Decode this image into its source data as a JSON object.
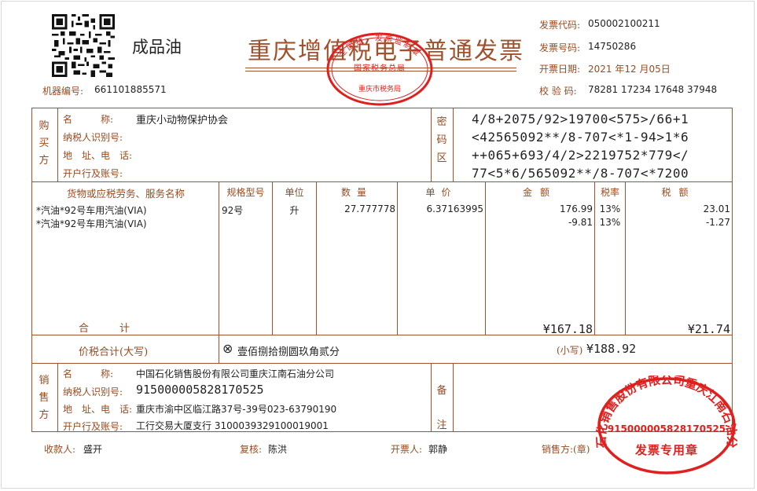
{
  "header": {
    "product_type": "成品油",
    "title": "重庆增值税电子普通发票",
    "machine_no_label": "机器编号:",
    "machine_no": "661101885571",
    "invoice_code_label": "发票代码:",
    "invoice_code": "050002100211",
    "invoice_no_label": "发票号码:",
    "invoice_no": "14750286",
    "issue_date_label": "开票日期:",
    "issue_date": "2021 年12 月05日",
    "check_code_label": "校 验 码:",
    "check_code": "78281 17234 17648 37948"
  },
  "buyer": {
    "section_label": "购买方",
    "name_label": "名　　　称:",
    "name": "重庆小动物保护协会",
    "tax_id_label": "纳税人识别号:",
    "tax_id": "",
    "address_label": "地　址、电　话:",
    "address": "",
    "bank_label": "开户行及账号:",
    "bank": ""
  },
  "cipher": {
    "section_label": "密码区",
    "lines": [
      "4/8+2075/92>19700<575>/66+1",
      "<42565092**/8-707<*1-94>1*6",
      "++065+693/4/2>2219752*779</",
      "77<5*6/565092**/8-707<*7200"
    ]
  },
  "items_table": {
    "headers": {
      "name": "货物或应税劳务、服务名称",
      "spec": "规格型号",
      "unit": "单位",
      "qty": "数量",
      "price": "单价",
      "amount": "金额",
      "rate": "税率",
      "tax": "税额"
    },
    "rows": [
      {
        "name": "*汽油*92号车用汽油(VIA)",
        "spec": "92号",
        "unit": "升",
        "qty": "27.777778",
        "price": "6.37163995",
        "amount": "176.99",
        "rate": "13%",
        "tax": "23.01"
      },
      {
        "name": "*汽油*92号车用汽油(VIA)",
        "spec": "",
        "unit": "",
        "qty": "",
        "price": "",
        "amount": "-9.81",
        "rate": "13%",
        "tax": "-1.27"
      }
    ],
    "total_label": "合　　　计",
    "total_amount": "¥167.18",
    "total_tax": "¥21.74"
  },
  "price_tax_total": {
    "label": "价税合计(大写)",
    "uppercase_symbol": "⊗",
    "uppercase": "壹佰捌拾捌圆玖角贰分",
    "lowercase_label": "(小写)",
    "lowercase": "¥188.92"
  },
  "seller": {
    "section_label": "销售方",
    "name_label": "名　　　称:",
    "name": "中国石化销售股份有限公司重庆江南石油分公司",
    "tax_id_label": "纳税人识别号:",
    "tax_id": "915000005828170525",
    "address_label": "地　址、电　话:",
    "address": "重庆市渝中区临江路37号-39号023-63790190",
    "bank_label": "开户行及账号:",
    "bank": "工行交易大厦支行 3100039329100019001"
  },
  "remarks": {
    "section_label": "备注",
    "text": ""
  },
  "footer": {
    "payee_label": "收款人:",
    "payee": "盛开",
    "reviewer_label": "复核:",
    "reviewer": "陈洪",
    "drawer_label": "开票人:",
    "drawer": "郭静",
    "seller_label": "销售方:(章)"
  },
  "stamps": {
    "tax_bureau_top": "国家税务总局",
    "tax_bureau_bottom": "重庆市税务局",
    "tax_bureau_ring": "全国统一发票监制章",
    "seller_ring": "中国石化销售股份有限公司重庆江南石油分公司",
    "seller_tax_id": "915000005828170525",
    "seller_type": "发票专用章"
  },
  "colors": {
    "frame": "#a0522d",
    "label": "#9b4a1e",
    "stamp": "#e0201e",
    "text": "#222222"
  }
}
